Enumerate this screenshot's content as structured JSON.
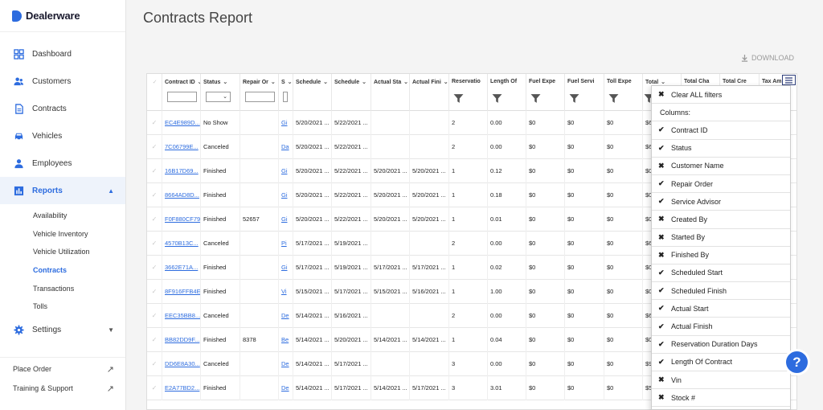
{
  "brand": "Dealerware",
  "nav": [
    {
      "label": "Dashboard",
      "icon": "dashboard-icon"
    },
    {
      "label": "Customers",
      "icon": "customers-icon"
    },
    {
      "label": "Contracts",
      "icon": "contracts-icon"
    },
    {
      "label": "Vehicles",
      "icon": "car-icon"
    },
    {
      "label": "Employees",
      "icon": "employee-icon"
    },
    {
      "label": "Reports",
      "icon": "reports-icon",
      "active": true,
      "caret": "▲"
    }
  ],
  "report_subnav": [
    "Availability",
    "Vehicle Inventory",
    "Vehicle Utilization",
    "Contracts",
    "Transactions",
    "Tolls"
  ],
  "settings": {
    "label": "Settings",
    "caret": "▼"
  },
  "bottom_links": [
    {
      "label": "Place Order",
      "icon": "external-link-icon"
    },
    {
      "label": "Training & Support",
      "icon": "external-link-icon"
    }
  ],
  "page_title": "Contracts Report",
  "download_label": "DOWNLOAD",
  "columns": [
    {
      "label": "Contract ID",
      "short": "Contract ID"
    },
    {
      "label": "Status",
      "short": "Status"
    },
    {
      "label": "Repair Order",
      "short": "Repair Or"
    },
    {
      "label": "Service Advisor",
      "short": "S"
    },
    {
      "label": "Scheduled Start",
      "short": "Schedule"
    },
    {
      "label": "Scheduled Finish",
      "short": "Schedule"
    },
    {
      "label": "Actual Start",
      "short": "Actual Sta"
    },
    {
      "label": "Actual Finish",
      "short": "Actual Fini"
    },
    {
      "label": "Reservation Duration Days",
      "short": "Reservatio"
    },
    {
      "label": "Length Of Contract",
      "short": "Length Of"
    },
    {
      "label": "Fuel Expense",
      "short": "Fuel Expe"
    },
    {
      "label": "Fuel Service",
      "short": "Fuel Servi"
    },
    {
      "label": "Toll Expense",
      "short": "Toll Expe"
    },
    {
      "label": "Total",
      "short": "Total"
    },
    {
      "label": "Total Charge",
      "short": "Total Cha"
    },
    {
      "label": "Total Credit",
      "short": "Total Cre"
    },
    {
      "label": "Tax Amount",
      "short": "Tax Am"
    }
  ],
  "rows": [
    [
      "EC4E989D...",
      "No Show",
      "",
      "Gi",
      "5/20/2021 ...",
      "5/22/2021 ...",
      "",
      "",
      "2",
      "0.00",
      "$0",
      "$0",
      "$0",
      "$6"
    ],
    [
      "7C06799E...",
      "Canceled",
      "",
      "Da",
      "5/20/2021 ...",
      "5/22/2021 ...",
      "",
      "",
      "2",
      "0.00",
      "$0",
      "$0",
      "$0",
      "$6"
    ],
    [
      "16B17D69...",
      "Finished",
      "",
      "Gi",
      "5/20/2021 ...",
      "5/22/2021 ...",
      "5/20/2021 ...",
      "5/20/2021 ...",
      "1",
      "0.12",
      "$0",
      "$0",
      "$0",
      "$0"
    ],
    [
      "8664AD8D...",
      "Finished",
      "",
      "Gi",
      "5/20/2021 ...",
      "5/22/2021 ...",
      "5/20/2021 ...",
      "5/20/2021 ...",
      "1",
      "0.18",
      "$0",
      "$0",
      "$0",
      "$0"
    ],
    [
      "F0F880CF79",
      "Finished",
      "52657",
      "Gi",
      "5/20/2021 ...",
      "5/22/2021 ...",
      "5/20/2021 ...",
      "5/20/2021 ...",
      "1",
      "0.01",
      "$0",
      "$0",
      "$0",
      "$0"
    ],
    [
      "4570B13C...",
      "Canceled",
      "",
      "Pi",
      "5/17/2021 ...",
      "5/19/2021 ...",
      "",
      "",
      "2",
      "0.00",
      "$0",
      "$0",
      "$0",
      "$6"
    ],
    [
      "3662E71A...",
      "Finished",
      "",
      "Gi",
      "5/17/2021 ...",
      "5/19/2021 ...",
      "5/17/2021 ...",
      "5/17/2021 ...",
      "1",
      "0.02",
      "$0",
      "$0",
      "$0",
      "$0"
    ],
    [
      "8F916FFB4E",
      "Finished",
      "",
      "Vi",
      "5/15/2021 ...",
      "5/17/2021 ...",
      "5/15/2021 ...",
      "5/16/2021 ...",
      "1",
      "1.00",
      "$0",
      "$0",
      "$0",
      "$0"
    ],
    [
      "EEC35BB8...",
      "Canceled",
      "",
      "De",
      "5/14/2021 ...",
      "5/16/2021 ...",
      "",
      "",
      "2",
      "0.00",
      "$0",
      "$0",
      "$0",
      "$6"
    ],
    [
      "BB82DD9F...",
      "Finished",
      "8378",
      "Be",
      "5/14/2021 ...",
      "5/20/2021 ...",
      "5/14/2021 ...",
      "5/14/2021 ...",
      "1",
      "0.04",
      "$0",
      "$0",
      "$0",
      "$0"
    ],
    [
      "DD6E8A30...",
      "Canceled",
      "",
      "De",
      "5/14/2021 ...",
      "5/17/2021 ...",
      "",
      "",
      "3",
      "0.00",
      "$0",
      "$0",
      "$0",
      "$9"
    ],
    [
      "E2A77BD2...",
      "Finished",
      "",
      "De",
      "5/14/2021 ...",
      "5/17/2021 ...",
      "5/14/2021 ...",
      "5/17/2021 ...",
      "3",
      "3.01",
      "$0",
      "$0",
      "$0",
      "$5"
    ]
  ],
  "column_menu": {
    "clear_all": "Clear ALL filters",
    "columns_label": "Columns:",
    "items": [
      {
        "label": "Contract ID",
        "on": true
      },
      {
        "label": "Status",
        "on": true
      },
      {
        "label": "Customer Name",
        "on": false
      },
      {
        "label": "Repair Order",
        "on": true
      },
      {
        "label": "Service Advisor",
        "on": true
      },
      {
        "label": "Created By",
        "on": false
      },
      {
        "label": "Started By",
        "on": false
      },
      {
        "label": "Finished By",
        "on": false
      },
      {
        "label": "Scheduled Start",
        "on": true
      },
      {
        "label": "Scheduled Finish",
        "on": true
      },
      {
        "label": "Actual Start",
        "on": true
      },
      {
        "label": "Actual Finish",
        "on": true
      },
      {
        "label": "Reservation Duration Days",
        "on": true
      },
      {
        "label": "Length Of Contract",
        "on": true
      },
      {
        "label": "Vin",
        "on": false
      },
      {
        "label": "Stock #",
        "on": false
      }
    ],
    "check_mark": "✔",
    "cross_mark": "✖"
  },
  "help_label": "?",
  "colors": {
    "accent": "#2d6cdf",
    "link": "#2d6cdf"
  }
}
